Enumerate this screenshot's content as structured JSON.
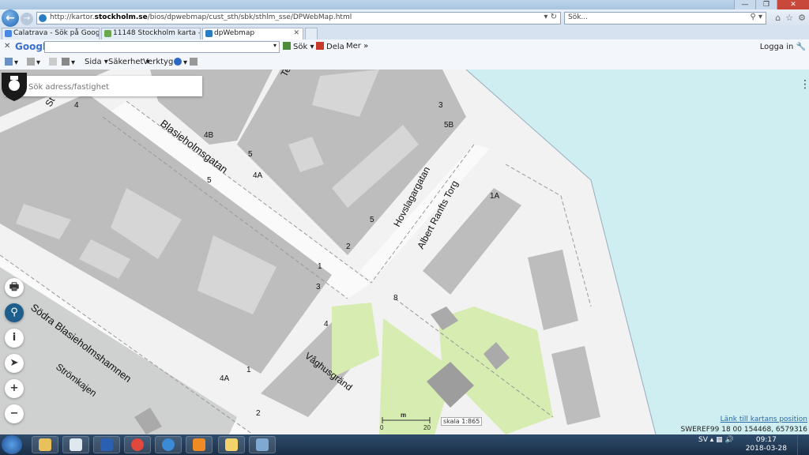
{
  "browser": {
    "url_prefix": "http://kartor.",
    "url_host": "stockholm.se",
    "url_path": "/bios/dpwebmap/cust_sth/sbk/sthlm_sse/DPWebMap.html",
    "search_placeholder": "Sök...",
    "tabs": [
      {
        "label": "Calatrava - Sök på Google"
      },
      {
        "label": "11148 Stockholm karta - hitta.se"
      },
      {
        "label": "dpWebmap",
        "active": true
      }
    ],
    "google_bar": {
      "logo": "Google",
      "sok_label": "Sök",
      "dela_label": "Dela",
      "mer_label": "Mer »",
      "logga_in_label": "Logga in"
    },
    "command_bar": {
      "sida_label": "Sida ▾",
      "sakerhet_label": "Säkerhet ▾",
      "verktyg_label": "Verktyg ▾"
    }
  },
  "map": {
    "search_placeholder": "Sök adress/fastighet",
    "street_labels": {
      "blasieholmsgatan": "Blasieholmsgatan",
      "hovslagargatan": "Hovslagargatan",
      "albert_ranfts_torg": "Albert Ranfts Torg",
      "sodra_blasieholmshamnen": "Södra Blasieholmshamnen",
      "stromkajen": "Strömkajen",
      "vaghusgrand": "Våghusgränd",
      "st_partial": "St",
      "te_partial": "Te"
    },
    "house_numbers": {
      "n4_top": "4",
      "n4b": "4B",
      "n5_a": "5",
      "n4a_top": "4A",
      "n5_b": "5",
      "n3_top": "3",
      "n5b": "5B",
      "n5_c": "5",
      "n2": "2",
      "n1a": "1A",
      "n1_a": "1",
      "n3_b": "3",
      "n8": "8",
      "n4_b": "4",
      "n1_b": "1",
      "n4a_b": "4A",
      "n2_b": "2"
    },
    "scale_unit": "m",
    "scale_min": "0",
    "scale_max": "20",
    "scale_label": "skala 1:865",
    "link_label": "Länk till kartans position",
    "coordinates": "SWEREF99 18 00 154468, 6579316",
    "colors": {
      "water": "#cfeef2",
      "land": "#f2f2f2",
      "building": "#bdbdbd",
      "park": "#d7ecb0",
      "accent": "#1d5e8c"
    }
  },
  "map_tools": [
    {
      "name": "print-icon",
      "glyph": "🖶"
    },
    {
      "name": "location-pin-icon",
      "glyph": "⚲"
    },
    {
      "name": "info-icon",
      "glyph": "i"
    },
    {
      "name": "navigate-icon",
      "glyph": "➤"
    },
    {
      "name": "zoom-in-icon",
      "glyph": "+"
    },
    {
      "name": "zoom-out-icon",
      "glyph": "−"
    }
  ],
  "taskbar": {
    "language": "SV",
    "time": "09:17",
    "date": "2018-03-28"
  }
}
